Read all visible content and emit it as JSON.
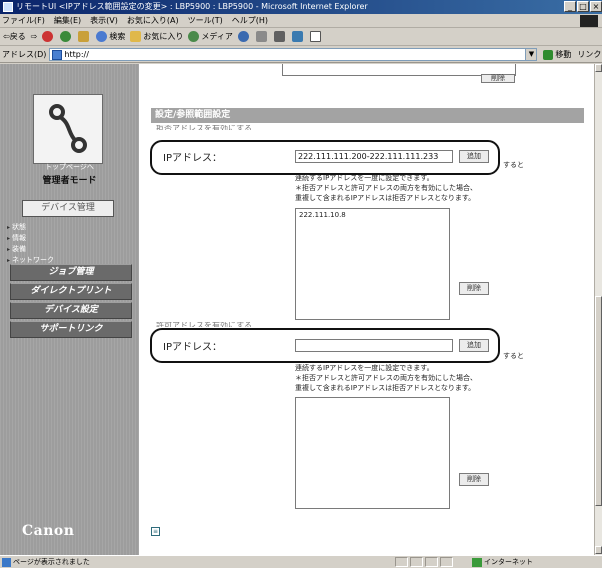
{
  "window": {
    "title": "リモートUI <IPアドレス範囲設定の変更> : LBP5900 : LBP5900 - Microsoft Internet Explorer",
    "buttons": [
      "_",
      "□",
      "×"
    ]
  },
  "menu": [
    "ファイル(F)",
    "編集(E)",
    "表示(V)",
    "お気に入り(A)",
    "ツール(T)",
    "ヘルプ(H)"
  ],
  "toolbar": {
    "back": "戻る",
    "search": "検索",
    "favorites": "お気に入り",
    "media": "メディア"
  },
  "address": {
    "label": "アドレス(D)",
    "value": "http://",
    "go": "移動",
    "links": "リンク"
  },
  "sidebar": {
    "logo_caption": "トップページへ",
    "mode": "管理者モード",
    "device_mgmt": "デバイス管理",
    "sub_items": [
      "状態",
      "情報",
      "装備",
      "ネットワーク"
    ],
    "nav": [
      "ジョブ管理",
      "ダイレクトプリント",
      "デバイス設定",
      "サポートリンク"
    ],
    "brand": "Canon"
  },
  "main": {
    "delete_label": "削除",
    "add_label": "追加",
    "section_title": "設定/参照範囲設定",
    "reject_header": "拒否アドレスを有効にする",
    "permit_header": "許可アドレスを有効にする",
    "ip_label": "IPアドレス：",
    "reject_ip_value": "222.111.111.200-222.111.111.233",
    "permit_ip_value": "",
    "note_trail": "すると",
    "note_lines": [
      "連続するIPアドレスを一度に設定できます。",
      "＊拒否アドレスと許可アドレスの両方を有効にした場合、",
      "重複して含まれるIPアドレスは拒否アドレスとなります。"
    ],
    "reject_list": [
      "222.111.10.8"
    ],
    "permit_list": []
  },
  "status": {
    "text": "ページが表示されました",
    "zone": "インターネット"
  }
}
